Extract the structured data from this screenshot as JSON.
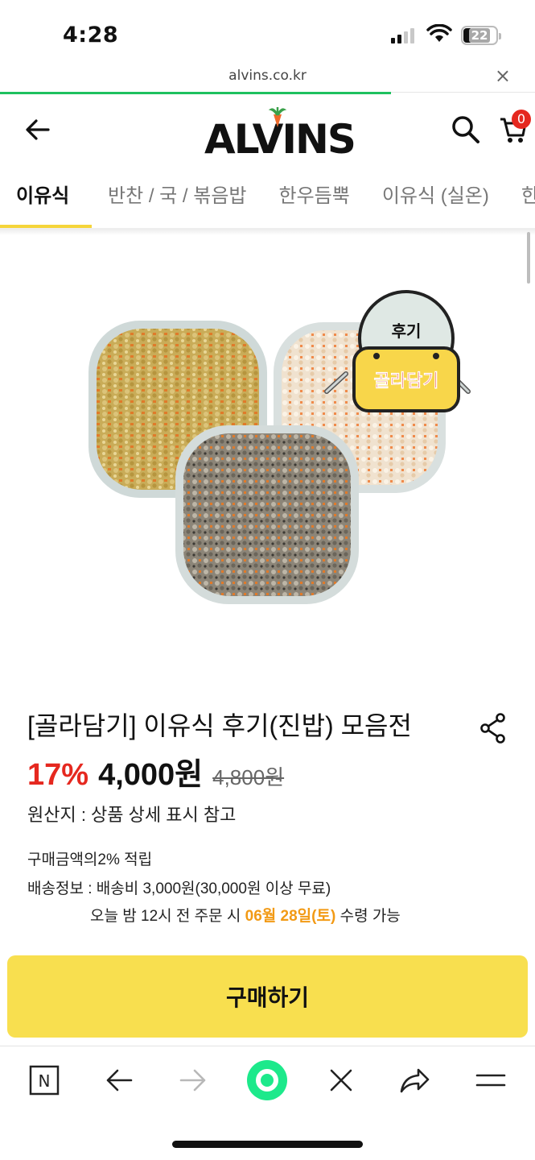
{
  "status_bar": {
    "time": "4:28",
    "battery": "22"
  },
  "browser": {
    "url": "alvins.co.kr"
  },
  "header": {
    "logo": "ALVINS",
    "cart_count": "0"
  },
  "tabs": [
    {
      "label": "이유식"
    },
    {
      "label": "반찬 / 국 / 볶음밥"
    },
    {
      "label": "한우듬뿍"
    },
    {
      "label": "이유식 (실온)"
    },
    {
      "label": "한"
    }
  ],
  "product": {
    "badge_top": "후기",
    "badge_bottom": "골라담기",
    "title": "[골라담기] 이유식 후기(진밥) 모음전",
    "discount": "17%",
    "price": "4,000원",
    "original_price": "4,800원",
    "origin": "원산지 : 상품 상세 표시 참고",
    "points": "구매금액의2% 적립",
    "shipping": "배송정보 : 배송비 3,000원(30,000원 이상 무료)",
    "delivery_prefix": "오늘 밤 12시 전 주문 시 ",
    "delivery_date": "06월 28일(토)",
    "delivery_suffix": " 수령 가능",
    "buy_label": "구매하기"
  },
  "colors": {
    "accent": "#f8df4f",
    "sale": "#e5281f",
    "delivery": "#f29a15",
    "progress": "#1ec15f"
  },
  "toolbar": {
    "icons": [
      "naver-n-icon",
      "back-arrow-icon",
      "forward-arrow-icon",
      "home-circle-icon",
      "close-icon",
      "share-icon",
      "menu-icon"
    ],
    "home_letter": "N"
  }
}
